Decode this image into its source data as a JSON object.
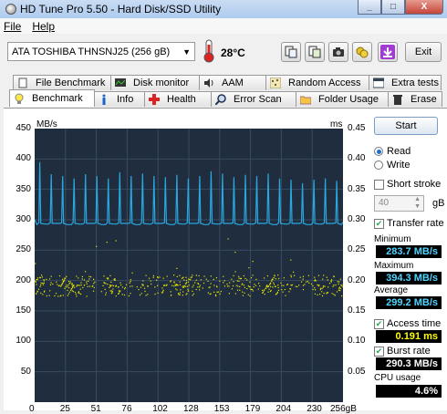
{
  "window": {
    "title": "HD Tune Pro 5.50 - Hard Disk/SSD Utility",
    "minimize": "_",
    "maximize": "□",
    "close": "X"
  },
  "menu": {
    "items": [
      "File",
      "Help"
    ]
  },
  "toolbar": {
    "drive": "ATA    TOSHIBA THNSNJ25 (256 gB)",
    "temperature": "28°C",
    "exit_label": "Exit"
  },
  "tabs_row1": [
    "File Benchmark",
    "Disk monitor",
    "AAM",
    "Random Access",
    "Extra tests"
  ],
  "tabs_row2": [
    "Benchmark",
    "Info",
    "Health",
    "Error Scan",
    "Folder Usage",
    "Erase"
  ],
  "controls": {
    "start_label": "Start",
    "read_label": "Read",
    "write_label": "Write",
    "short_stroke_label": "Short stroke",
    "stroke_value": "40",
    "stroke_unit": "gB",
    "transfer_rate_label": "Transfer rate",
    "minimum_label": "Minimum",
    "minimum_value": "283.7 MB/s",
    "maximum_label": "Maximum",
    "maximum_value": "394.3 MB/s",
    "average_label": "Average",
    "average_value": "299.2 MB/s",
    "access_time_label": "Access time",
    "access_time_value": "0.191 ms",
    "burst_rate_label": "Burst rate",
    "burst_rate_value": "290.3 MB/s",
    "cpu_label": "CPU usage",
    "cpu_value": "4.6%",
    "value_color_cyan": "#4fd3ff",
    "value_color_yellow": "#ffff00",
    "value_color_white": "#ffffff"
  },
  "chart_data": {
    "type": "line",
    "y_left_unit": "MB/s",
    "y_right_unit": "ms",
    "y_left_ticks": [
      "450",
      "400",
      "350",
      "300",
      "250",
      "200",
      "150",
      "100",
      "50"
    ],
    "y_right_ticks": [
      "0.45",
      "0.40",
      "0.35",
      "0.30",
      "0.25",
      "0.20",
      "0.15",
      "0.10",
      "0.05"
    ],
    "x_ticks": [
      "0",
      "25",
      "51",
      "76",
      "102",
      "128",
      "153",
      "179",
      "204",
      "230",
      "256gB"
    ],
    "ylim_left": [
      0,
      450
    ],
    "ylim_right": [
      0,
      0.45
    ],
    "xlim": [
      0,
      256
    ],
    "series": [
      {
        "color": "#29a8e0",
        "baseline": 293,
        "spike_peaks": [
          395,
          375,
          372,
          368,
          375,
          372,
          368,
          378,
          372,
          376,
          372,
          370,
          374,
          368,
          372,
          380,
          376,
          370,
          374,
          372,
          376,
          368,
          366,
          360,
          366,
          368,
          364
        ]
      },
      {
        "color": "#e8e800",
        "access_time_band_ms": [
          0.18,
          0.2
        ]
      }
    ],
    "grid": true
  }
}
